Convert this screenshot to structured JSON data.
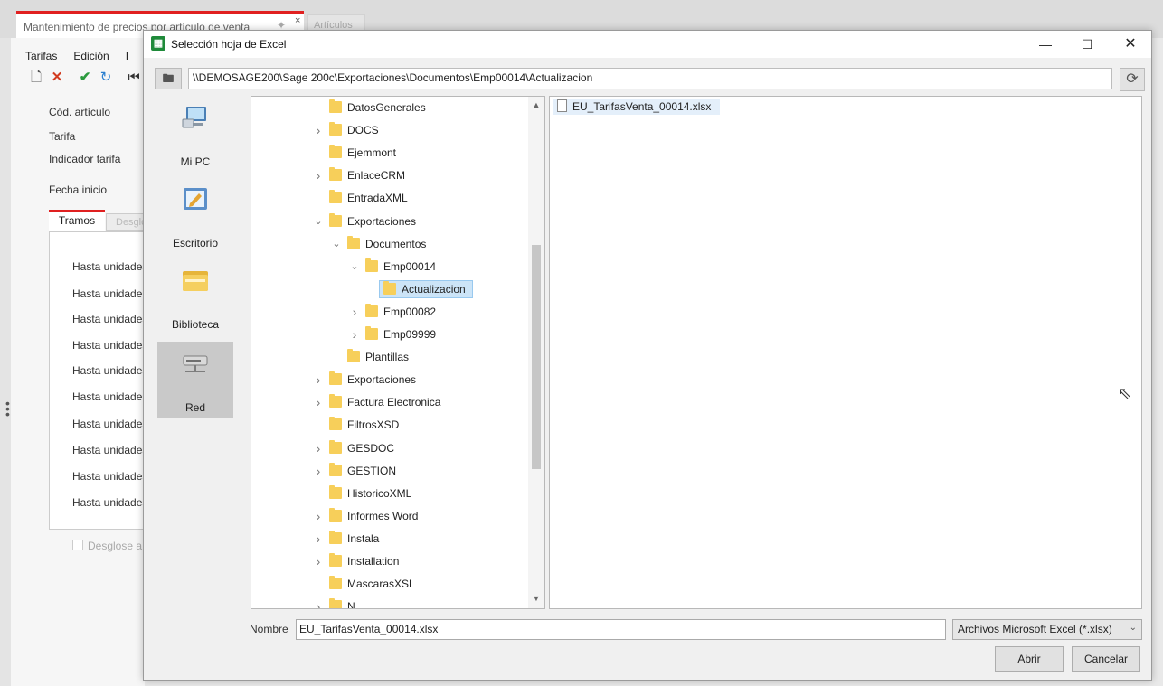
{
  "background_app": {
    "tab_title": "Mantenimiento de precios por artículo de venta",
    "tab_close": "×",
    "tab2_title": "Artículos",
    "menu": [
      "Tarifas",
      "Edición",
      "I"
    ],
    "fields": [
      "Cód. artículo",
      "Tarifa",
      "Indicador tarifa",
      "Fecha inicio"
    ],
    "tabs": [
      "Tramos",
      "Desglose"
    ],
    "rows": [
      "Hasta unidades",
      "Hasta unidades",
      "Hasta unidades",
      "Hasta unidades",
      "Hasta unidades",
      "Hasta unidades",
      "Hasta unidades",
      "Hasta unidades",
      "Hasta unidades",
      "Hasta unidades"
    ],
    "checkbox_label": "Desglose a"
  },
  "dialog": {
    "title": "Selección hoja de Excel",
    "path": "\\\\DEMOSAGE200\\Sage 200c\\Exportaciones\\Documentos\\Emp00014\\Actualizacion",
    "places": [
      "Mi PC",
      "Escritorio",
      "Biblioteca",
      "Red"
    ],
    "active_place": "Red",
    "tree": [
      {
        "name": "DatosGenerales",
        "level": 0,
        "chev": ""
      },
      {
        "name": "DOCS",
        "level": 0,
        "chev": ">"
      },
      {
        "name": "Ejemmont",
        "level": 0,
        "chev": ""
      },
      {
        "name": "EnlaceCRM",
        "level": 0,
        "chev": ">"
      },
      {
        "name": "EntradaXML",
        "level": 0,
        "chev": ""
      },
      {
        "name": "Exportaciones",
        "level": 0,
        "chev": "v"
      },
      {
        "name": "Documentos",
        "level": 1,
        "chev": "v"
      },
      {
        "name": "Emp00014",
        "level": 2,
        "chev": "v"
      },
      {
        "name": "Actualizacion",
        "level": 3,
        "chev": "",
        "selected": true
      },
      {
        "name": "Emp00082",
        "level": 2,
        "chev": ">"
      },
      {
        "name": "Emp09999",
        "level": 2,
        "chev": ">"
      },
      {
        "name": "Plantillas",
        "level": 1,
        "chev": ""
      },
      {
        "name": "Exportaciones",
        "level": 0,
        "chev": ">"
      },
      {
        "name": "Factura Electronica",
        "level": 0,
        "chev": ">"
      },
      {
        "name": "FiltrosXSD",
        "level": 0,
        "chev": ""
      },
      {
        "name": "GESDOC",
        "level": 0,
        "chev": ">"
      },
      {
        "name": "GESTION",
        "level": 0,
        "chev": ">"
      },
      {
        "name": "HistoricoXML",
        "level": 0,
        "chev": ""
      },
      {
        "name": "Informes Word",
        "level": 0,
        "chev": ">"
      },
      {
        "name": "Instala",
        "level": 0,
        "chev": ">"
      },
      {
        "name": "Installation",
        "level": 0,
        "chev": ">"
      },
      {
        "name": "MascarasXSL",
        "level": 0,
        "chev": ""
      },
      {
        "name": "N...",
        "level": 0,
        "chev": ">"
      }
    ],
    "files": [
      "EU_TarifasVenta_00014.xlsx"
    ],
    "nombre_label": "Nombre",
    "nombre_value": "EU_TarifasVenta_00014.xlsx",
    "filter": "Archivos Microsoft Excel (*.xlsx)",
    "open_button": "Abrir",
    "cancel_button": "Cancelar"
  }
}
